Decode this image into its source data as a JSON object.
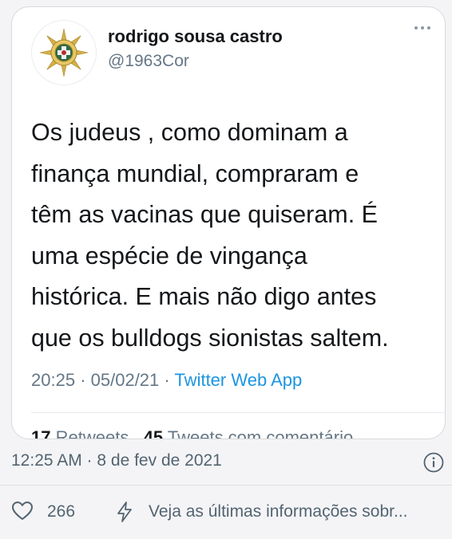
{
  "tweet": {
    "display_name": "rodrigo sousa castro",
    "handle": "@1963Cor",
    "text_lines": [
      "Os judeus , como dominam a",
      "finança mundial, compraram e",
      "têm as vacinas que quiseram. É",
      "uma espécie de vingança",
      "histórica. E mais não digo antes",
      "que os bulldogs sionistas saltem."
    ],
    "time": "20:25",
    "date": "05/02/21",
    "meta_separator": "·",
    "app": "Twitter Web App",
    "retweets_count": "17",
    "retweets_label": "Retweets",
    "quotes_count": "45",
    "quotes_label": "Tweets com comentário"
  },
  "post": {
    "timestamp": "12:25 AM · 8 de fev de 2021",
    "likes": "266",
    "latest_info": "Veja as últimas informações sobr..."
  },
  "icons": {
    "more": "more-dots-icon",
    "info": "info-icon",
    "like": "heart-icon",
    "latest": "lightning-bolt-icon"
  },
  "colors": {
    "link_blue": "#1b95e0",
    "muted_gray": "#657786",
    "text_dark": "#14171a",
    "avatar_gold": "#c9a441"
  }
}
